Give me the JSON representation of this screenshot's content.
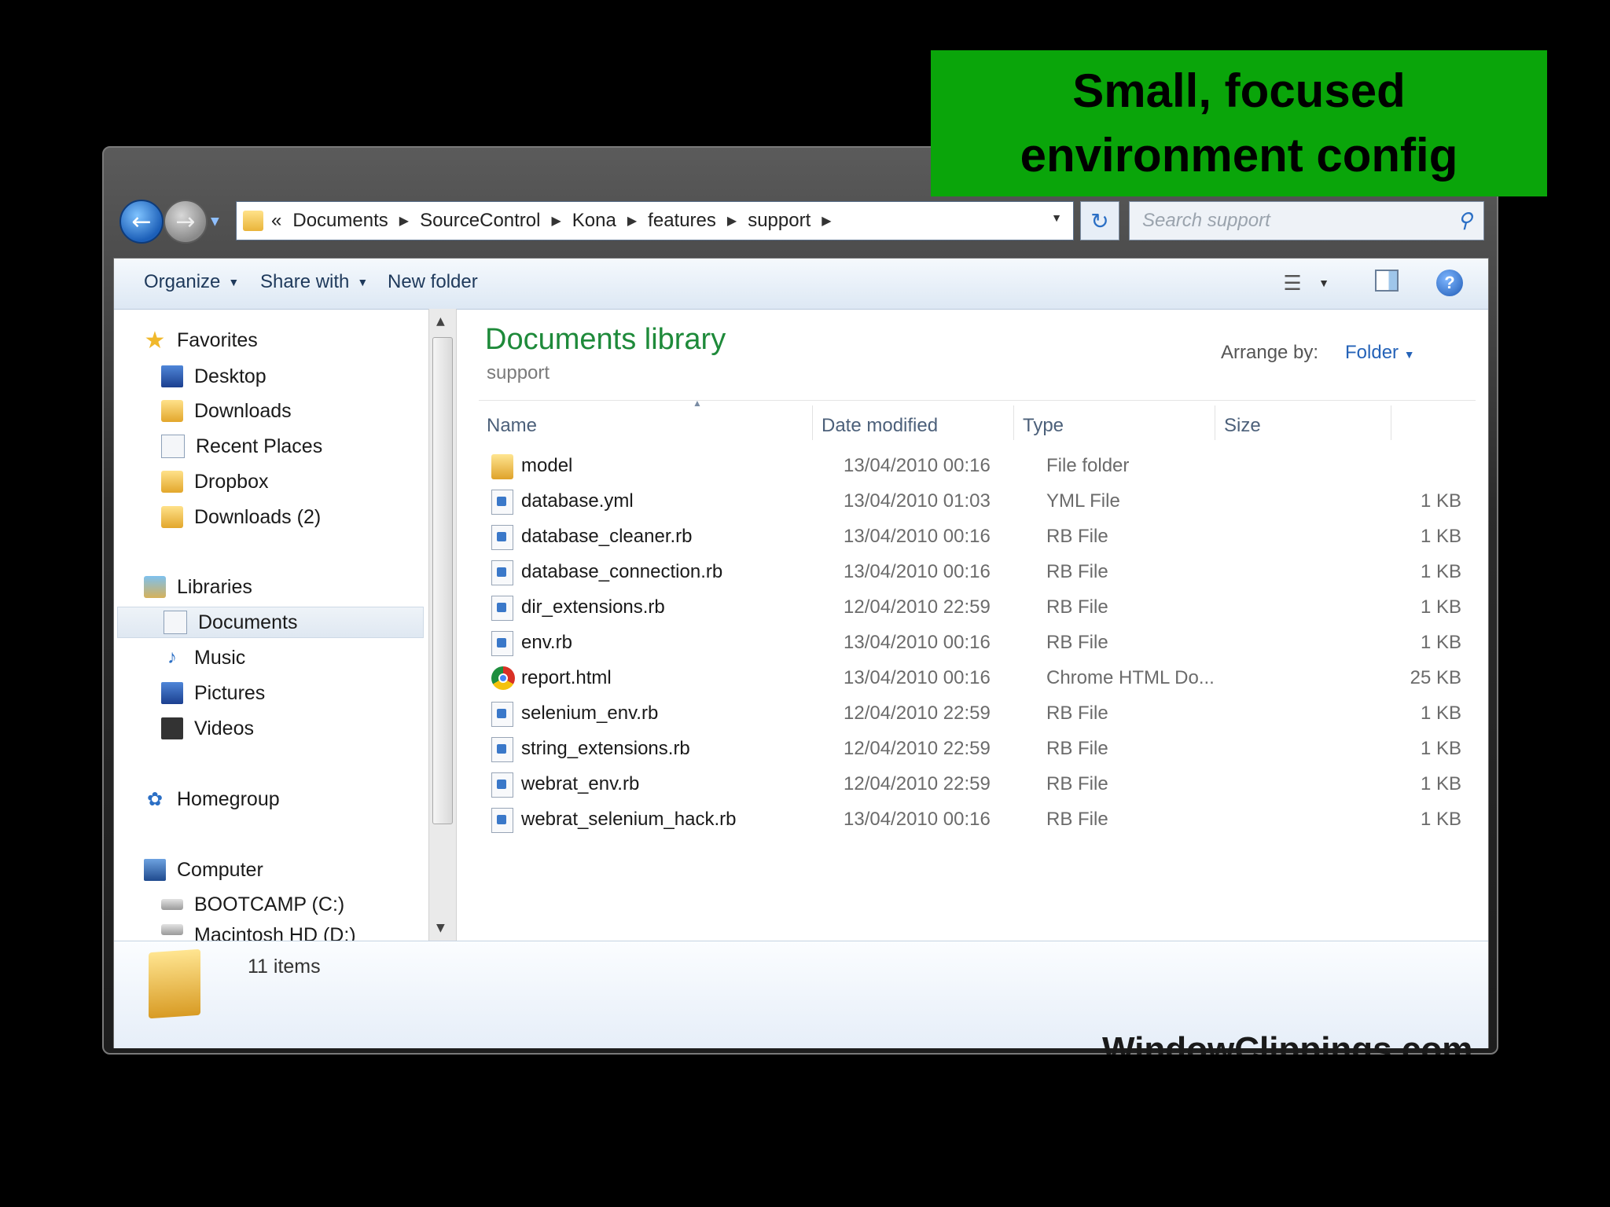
{
  "banner": {
    "line1": "Small, focused",
    "line2": "environment config"
  },
  "address": {
    "prefix": "«",
    "crumbs": [
      "Documents",
      "SourceControl",
      "Kona",
      "features",
      "support"
    ],
    "search_placeholder": "Search support"
  },
  "toolbar": {
    "organize": "Organize",
    "share_with": "Share with",
    "new_folder": "New folder"
  },
  "nav": {
    "favorites": "Favorites",
    "favorites_items": [
      "Desktop",
      "Downloads",
      "Recent Places",
      "Dropbox",
      "Downloads (2)"
    ],
    "libraries": "Libraries",
    "libraries_items": [
      "Documents",
      "Music",
      "Pictures",
      "Videos"
    ],
    "homegroup": "Homegroup",
    "computer": "Computer",
    "computer_items": [
      "BOOTCAMP (C:)",
      "Macintosh HD (D:)"
    ]
  },
  "content": {
    "title": "Documents library",
    "subtitle": "support",
    "arrange_label": "Arrange by:",
    "arrange_value": "Folder",
    "columns": [
      "Name",
      "Date modified",
      "Type",
      "Size"
    ],
    "rows": [
      {
        "name": "model",
        "date": "13/04/2010 00:16",
        "type": "File folder",
        "size": "",
        "icon": "folder"
      },
      {
        "name": "database.yml",
        "date": "13/04/2010 01:03",
        "type": "YML File",
        "size": "1 KB",
        "icon": "file"
      },
      {
        "name": "database_cleaner.rb",
        "date": "13/04/2010 00:16",
        "type": "RB File",
        "size": "1 KB",
        "icon": "file"
      },
      {
        "name": "database_connection.rb",
        "date": "13/04/2010 00:16",
        "type": "RB File",
        "size": "1 KB",
        "icon": "file"
      },
      {
        "name": "dir_extensions.rb",
        "date": "12/04/2010 22:59",
        "type": "RB File",
        "size": "1 KB",
        "icon": "file"
      },
      {
        "name": "env.rb",
        "date": "13/04/2010 00:16",
        "type": "RB File",
        "size": "1 KB",
        "icon": "file"
      },
      {
        "name": "report.html",
        "date": "13/04/2010 00:16",
        "type": "Chrome HTML Do...",
        "size": "25 KB",
        "icon": "chrome"
      },
      {
        "name": "selenium_env.rb",
        "date": "12/04/2010 22:59",
        "type": "RB File",
        "size": "1 KB",
        "icon": "file"
      },
      {
        "name": "string_extensions.rb",
        "date": "12/04/2010 22:59",
        "type": "RB File",
        "size": "1 KB",
        "icon": "file"
      },
      {
        "name": "webrat_env.rb",
        "date": "12/04/2010 22:59",
        "type": "RB File",
        "size": "1 KB",
        "icon": "file"
      },
      {
        "name": "webrat_selenium_hack.rb",
        "date": "13/04/2010 00:16",
        "type": "RB File",
        "size": "1 KB",
        "icon": "file"
      }
    ]
  },
  "details": {
    "items_count": "11 items"
  },
  "watermark": "WindowClippings.com"
}
